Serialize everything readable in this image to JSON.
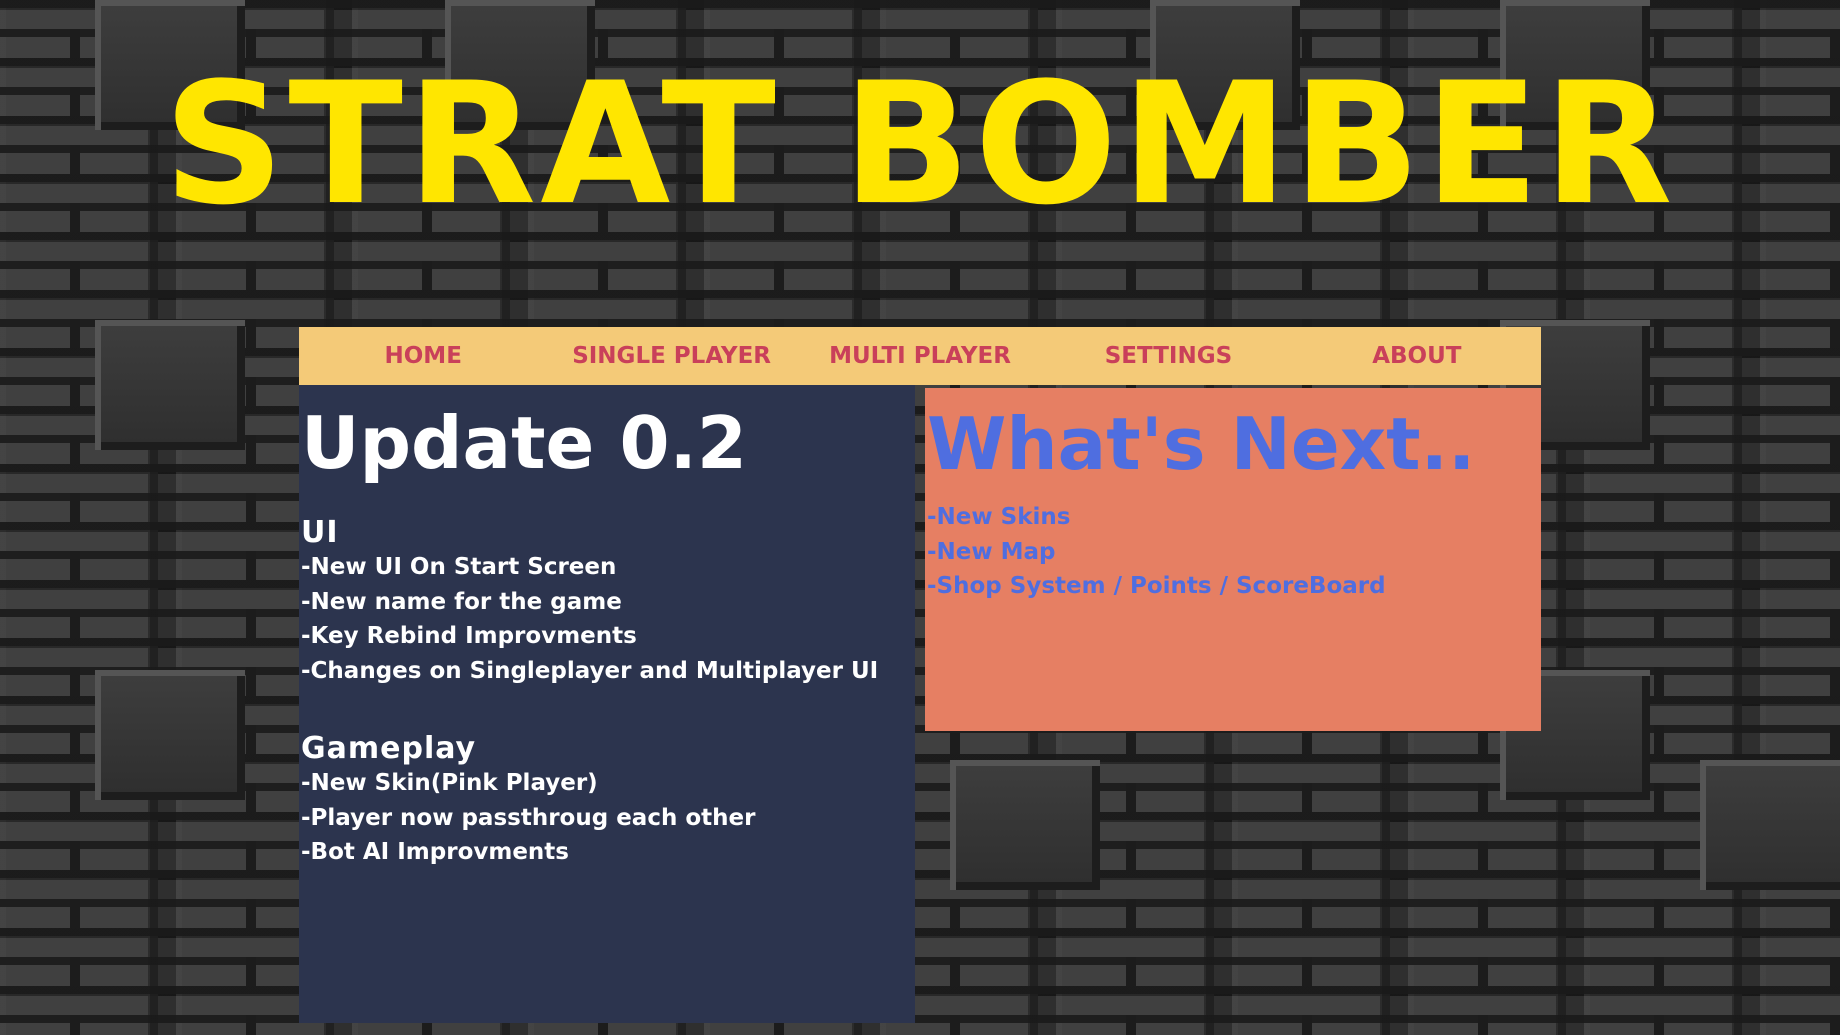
{
  "app": {
    "title": "STRAT BOMBER"
  },
  "nav": {
    "items": [
      {
        "label": "HOME"
      },
      {
        "label": "SINGLE PLAYER"
      },
      {
        "label": "MULTI PLAYER"
      },
      {
        "label": "SETTINGS"
      },
      {
        "label": "ABOUT"
      }
    ]
  },
  "update": {
    "title": "Update 0.2",
    "sections": [
      {
        "heading": "UI",
        "items": [
          "-New UI On Start Screen",
          "-New name for the game",
          "-Key Rebind Improvments",
          "-Changes on Singleplayer and Multiplayer UI"
        ]
      },
      {
        "heading": "Gameplay",
        "items": [
          "-New Skin(Pink Player)",
          "-Player now passthroug each other",
          "-Bot AI Improvments"
        ]
      }
    ]
  },
  "next": {
    "title": "What's Next..",
    "items": [
      "-New Skins",
      "-New Map",
      "-Shop System / Points / ScoreBoard"
    ]
  },
  "colors": {
    "title": "#ffe600",
    "nav_bg": "#f4ca78",
    "nav_text": "#c9405a",
    "update_bg": "#2c344e",
    "next_bg": "#e67f63",
    "next_text": "#4f6ee0"
  }
}
